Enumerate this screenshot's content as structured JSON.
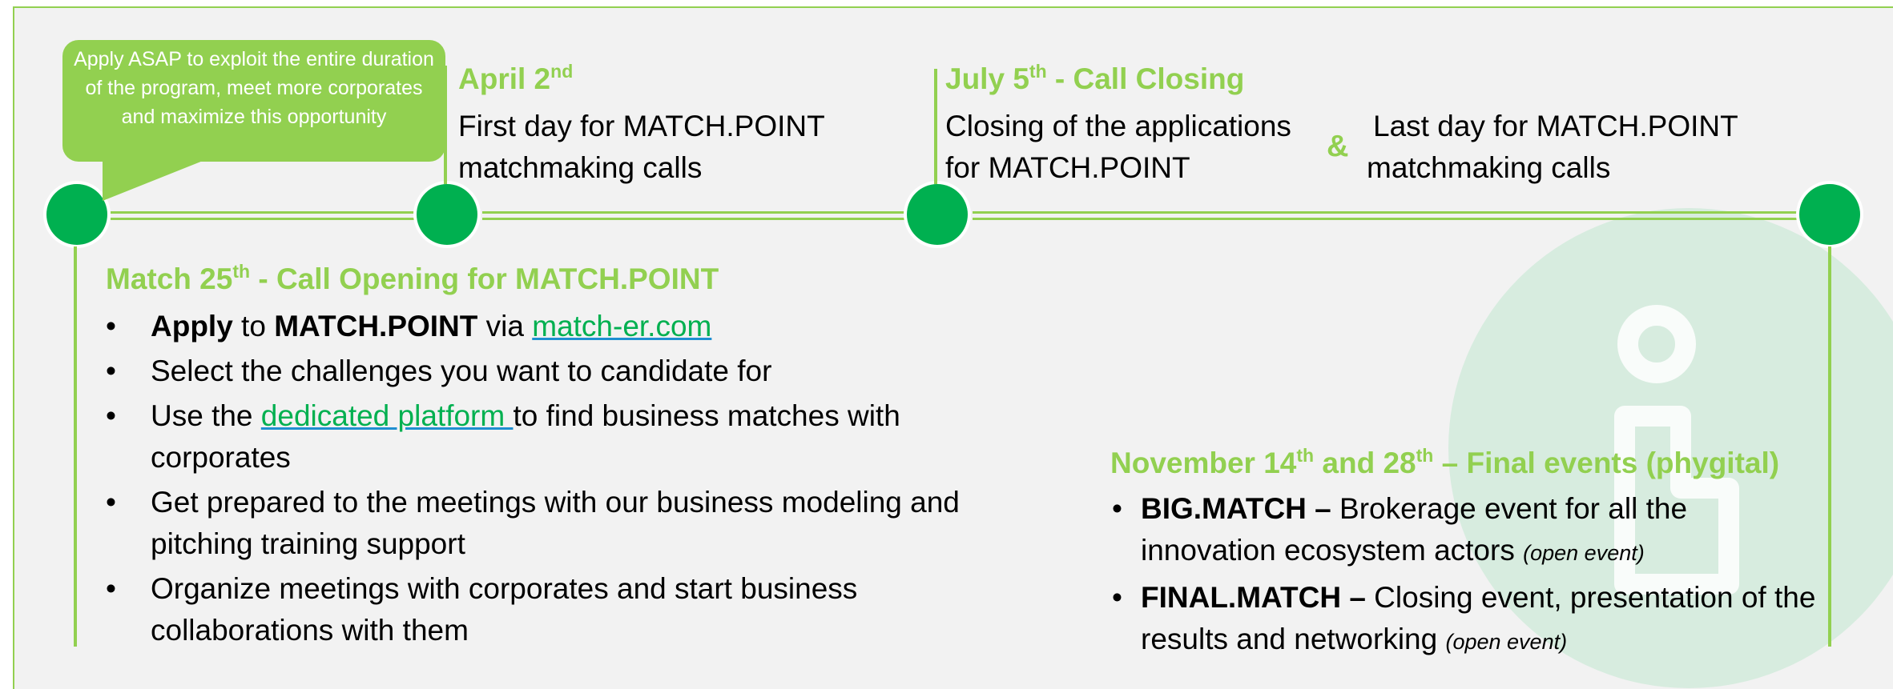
{
  "bubble": {
    "text": "Apply ASAP to exploit the entire duration of the program, meet more corporates and maximize this opportunity"
  },
  "milestones": {
    "april": {
      "title": "April 2",
      "title_sup": "nd",
      "desc_line1": "First day for MATCH.POINT",
      "desc_line2": "matchmaking calls"
    },
    "july": {
      "title": "July 5",
      "title_sup": "th",
      "title_suffix": " - Call Closing",
      "desc_line1": "Closing of the applications",
      "desc_line2": "for MATCH.POINT",
      "ampersand": "&",
      "desc2_line1": "Last day for MATCH.POINT",
      "desc2_line2": "matchmaking calls"
    },
    "march": {
      "title": "Match 25",
      "title_sup": "th",
      "title_suffix": " - Call Opening for MATCH.POINT",
      "bullets": {
        "b1_bold1": "Apply",
        "b1_text1": " to ",
        "b1_bold2": "MATCH.POINT",
        "b1_text2": " via ",
        "b1_link": "match-er.com",
        "b2": "Select the challenges you want to candidate for",
        "b3_text1": "Use the ",
        "b3_link": "dedicated platform ",
        "b3_text2": "to find business matches with corporates",
        "b4": "Get prepared to the meetings with our business modeling and pitching training support",
        "b5": "Organize meetings with corporates and start business collaborations with them"
      }
    },
    "november": {
      "title": "November 14",
      "title_sup1": "th",
      "title_mid": " and 28",
      "title_sup2": "th",
      "title_suffix": " – Final events (phygital)",
      "bullets": {
        "b1_bold": "BIG.MATCH –",
        "b1_text": " Brokerage event for all the innovation ecosystem actors ",
        "b1_em": "(open event)",
        "b2_bold": "FINAL.MATCH –",
        "b2_text": " Closing event, presentation of the results and networking ",
        "b2_em": "(open event)"
      }
    }
  },
  "colors": {
    "accent_green": "#92d050",
    "node_green": "#00b050",
    "background": "#f2f2f2",
    "link_underline": "#1f8fd1"
  }
}
